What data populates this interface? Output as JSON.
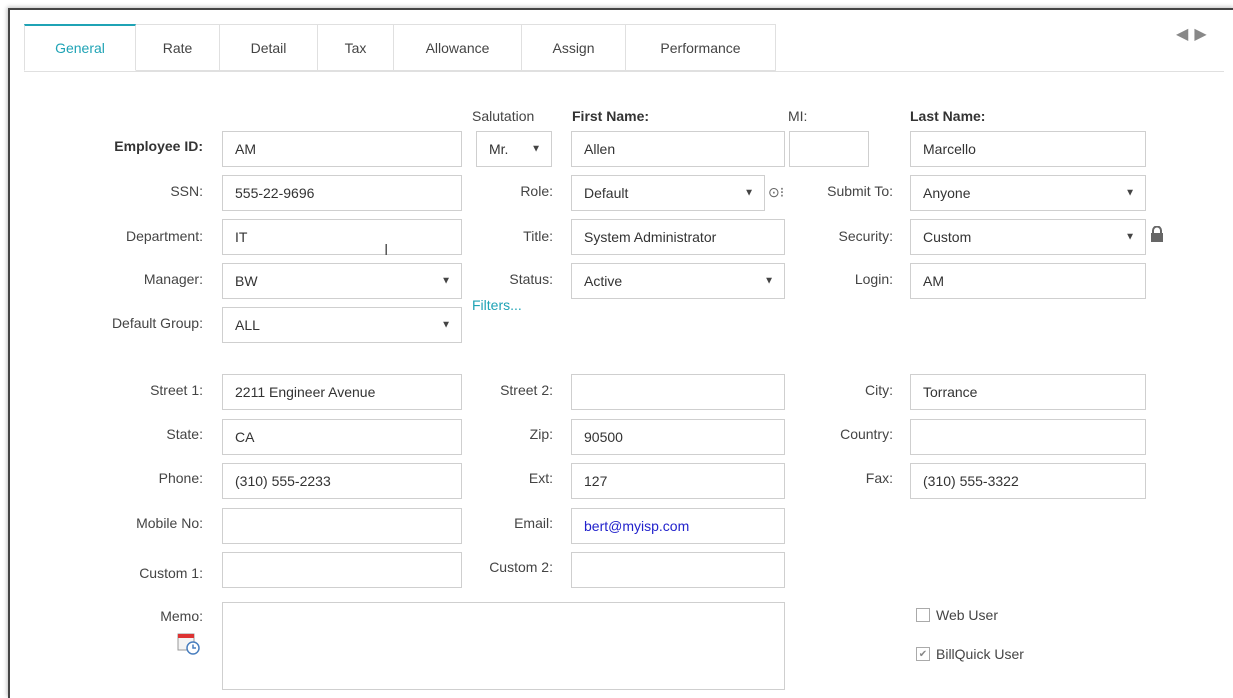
{
  "tabs": [
    "General",
    "Rate",
    "Detail",
    "Tax",
    "Allowance",
    "Assign",
    "Performance"
  ],
  "active_tab": "General",
  "labels": {
    "salutation": "Salutation",
    "first_name": "First Name:",
    "mi": "MI:",
    "last_name": "Last Name:",
    "employee_id": "Employee ID:",
    "ssn": "SSN:",
    "role": "Role:",
    "submit_to": "Submit To:",
    "department": "Department:",
    "title": "Title:",
    "security": "Security:",
    "manager": "Manager:",
    "status": "Status:",
    "login": "Login:",
    "default_group": "Default Group:",
    "street1": "Street 1:",
    "street2": "Street 2:",
    "city": "City:",
    "state": "State:",
    "zip": "Zip:",
    "country": "Country:",
    "phone": "Phone:",
    "ext": "Ext:",
    "fax": "Fax:",
    "mobile": "Mobile No:",
    "email": "Email:",
    "custom1": "Custom 1:",
    "custom2": "Custom 2:",
    "memo": "Memo:"
  },
  "values": {
    "employee_id": "AM",
    "salutation": "Mr.",
    "first_name": "Allen",
    "mi": "",
    "last_name": "Marcello",
    "ssn": "555-22-9696",
    "role": "Default",
    "submit_to": "Anyone",
    "department": "IT",
    "title": "System Administrator",
    "security": "Custom",
    "manager": "BW",
    "status": "Active",
    "login": "AM",
    "default_group": "ALL",
    "street1": "2211 Engineer Avenue",
    "street2": "",
    "city": "Torrance",
    "state": "CA",
    "zip": "90500",
    "country": "",
    "phone": "(310) 555-2233",
    "ext": "127",
    "fax": "(310) 555-3322",
    "mobile": "",
    "email": "bert@myisp.com",
    "custom1": "",
    "custom2": "",
    "memo": ""
  },
  "filters_link": "Filters...",
  "checkboxes": {
    "web_user": {
      "label": "Web User",
      "checked": false
    },
    "billquick_user": {
      "label": "BillQuick User",
      "checked": true
    }
  },
  "colors": {
    "accent": "#1fa3b5",
    "email": "#2222cc"
  }
}
